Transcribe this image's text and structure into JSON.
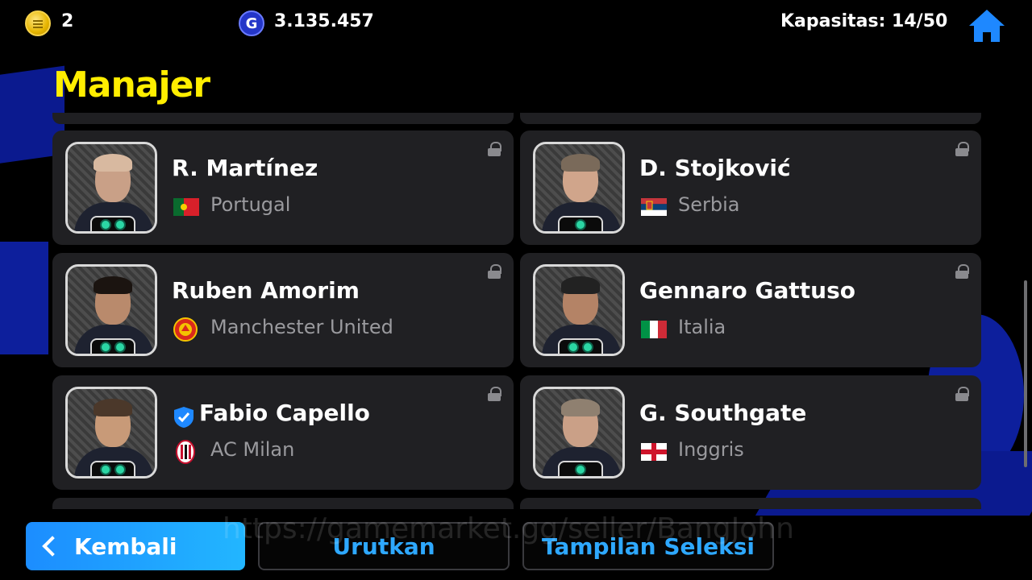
{
  "topbar": {
    "coins": "2",
    "gp": "3.135.457",
    "gp_symbol": "G",
    "capacity": "Kapasitas: 14/50",
    "coin_icon": "coin-icon",
    "gp_icon": "gp-icon",
    "home_icon": "home-icon"
  },
  "page": {
    "title": "Manajer"
  },
  "managers": [
    {
      "name": "R. Martínez",
      "country": "Portugal",
      "affiliation_type": "flag",
      "flag": "portugal-flag-icon",
      "hair": "#d8b9a0",
      "skin": "#c9a087",
      "badges": 2
    },
    {
      "name": "D. Stojković",
      "country": "Serbia",
      "affiliation_type": "flag",
      "flag": "serbia-flag-icon",
      "hair": "#7a6a5a",
      "skin": "#d0a58b",
      "badges": 1
    },
    {
      "name": "Ruben Amorim",
      "country": "Manchester United",
      "affiliation_type": "club",
      "flag": "manchester-united-crest-icon",
      "hair": "#1b1410",
      "skin": "#b98a6c",
      "badges": 2
    },
    {
      "name": "Gennaro Gattuso",
      "country": "Italia",
      "affiliation_type": "flag",
      "flag": "italy-flag-icon",
      "hair": "#222",
      "skin": "#b48366",
      "badges": 2
    },
    {
      "name": "Fabio Capello",
      "country": "AC Milan",
      "affiliation_type": "club",
      "flag": "ac-milan-crest-icon",
      "hair": "#4b382a",
      "skin": "#c89a78",
      "badges": 2,
      "verified": true
    },
    {
      "name": "G. Southgate",
      "country": "Inggris",
      "affiliation_type": "flag",
      "flag": "england-flag-icon",
      "hair": "#8f8070",
      "skin": "#caa087",
      "badges": 1
    }
  ],
  "buttons": {
    "back": "Kembali",
    "sort": "Urutkan",
    "view": "Tampilan Seleksi"
  },
  "watermark": "https://gamemarket.gg/seller/BangJohn",
  "colors": {
    "title": "#ffee00",
    "accent": "#2ea8ff",
    "card_bg": "#202023",
    "secondary_text": "#9a9a9e"
  }
}
